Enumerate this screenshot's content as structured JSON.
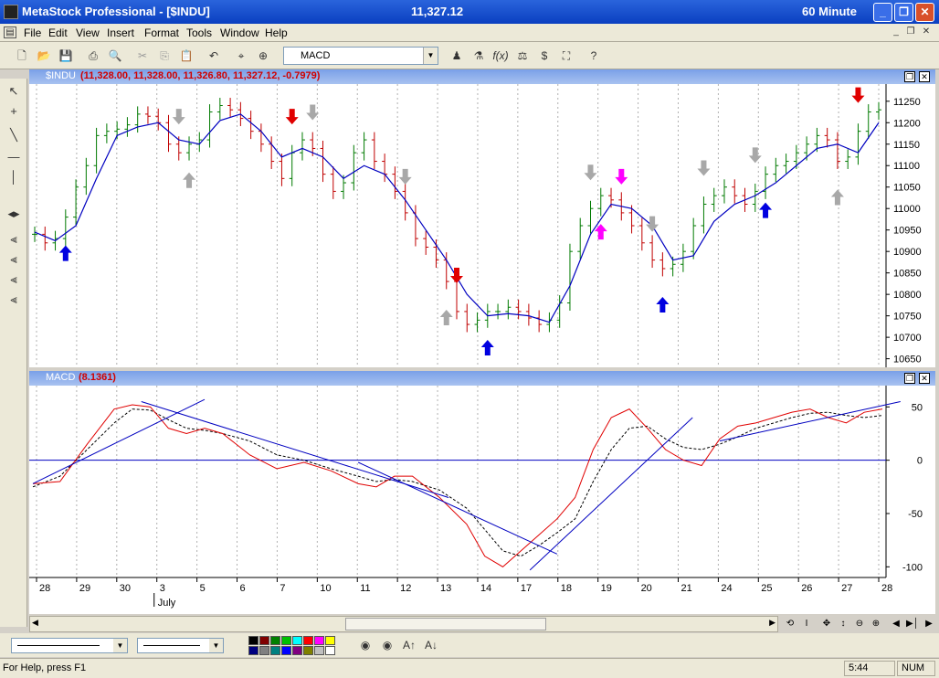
{
  "window": {
    "title": "MetaStock Professional - [$INDU]",
    "price": "11,327.12",
    "period": "60 Minute"
  },
  "menu": [
    "File",
    "Edit",
    "View",
    "Insert",
    "Format",
    "Tools",
    "Window",
    "Help"
  ],
  "toolbar": {
    "indicator_selected": "MACD"
  },
  "price_panel": {
    "name": "$INDU",
    "values": "(11,328.00, 11,328.00, 11,326.80, 11,327.12, -0.7979)",
    "yticks": [
      "11250",
      "11200",
      "11150",
      "11100",
      "11050",
      "11000",
      "10950",
      "10900",
      "10850",
      "10800",
      "10750",
      "10700",
      "10650"
    ]
  },
  "macd_panel": {
    "name": "MACD",
    "value": "(8.1361)",
    "yticks": [
      "50",
      "0",
      "-50",
      "-100"
    ]
  },
  "xaxis": {
    "dates": [
      "28",
      "29",
      "30",
      "3",
      "5",
      "6",
      "7",
      "10",
      "11",
      "12",
      "13",
      "14",
      "17",
      "18",
      "19",
      "20",
      "21",
      "24",
      "25",
      "26",
      "27",
      "28"
    ],
    "month": "July"
  },
  "status": {
    "help": "For Help, press F1",
    "time": "5:44",
    "num": "NUM"
  },
  "colors": {
    "up_bar": "#007a00",
    "down_bar": "#c00000",
    "ma_line": "#0000c0",
    "macd_line": "#e00000",
    "signal_line": "#000000",
    "trend_line": "#0000c0",
    "arrow_gray": "#a8a8a8",
    "arrow_red": "#e00000",
    "arrow_blue": "#0000e0",
    "arrow_magenta": "#ff00ff",
    "header_values": "#d00000"
  },
  "chart_data": [
    {
      "type": "candlestick-bar",
      "symbol": "$INDU",
      "interval": "60 Minute",
      "ylim": [
        10630,
        11290
      ],
      "close_path": [
        [
          0,
          10940
        ],
        [
          1,
          10920
        ],
        [
          2,
          10930
        ],
        [
          3,
          10980
        ],
        [
          4,
          11050
        ],
        [
          5,
          11100
        ],
        [
          6,
          11170
        ],
        [
          7,
          11180
        ],
        [
          8,
          11185
        ],
        [
          9,
          11195
        ],
        [
          10,
          11220
        ],
        [
          11,
          11215
        ],
        [
          12,
          11200
        ],
        [
          13,
          11150
        ],
        [
          14,
          11130
        ],
        [
          15,
          11150
        ],
        [
          16,
          11160
        ],
        [
          17,
          11225
        ],
        [
          18,
          11240
        ],
        [
          19,
          11230
        ],
        [
          20,
          11210
        ],
        [
          21,
          11180
        ],
        [
          22,
          11150
        ],
        [
          23,
          11110
        ],
        [
          24,
          11070
        ],
        [
          25,
          11130
        ],
        [
          26,
          11160
        ],
        [
          27,
          11140
        ],
        [
          28,
          11080
        ],
        [
          29,
          11040
        ],
        [
          30,
          11060
        ],
        [
          31,
          11130
        ],
        [
          32,
          11160
        ],
        [
          33,
          11110
        ],
        [
          34,
          11080
        ],
        [
          35,
          11040
        ],
        [
          36,
          10990
        ],
        [
          37,
          10930
        ],
        [
          38,
          10910
        ],
        [
          39,
          10880
        ],
        [
          40,
          10830
        ],
        [
          41,
          10760
        ],
        [
          42,
          10730
        ],
        [
          43,
          10740
        ],
        [
          44,
          10760
        ],
        [
          45,
          10760
        ],
        [
          46,
          10770
        ],
        [
          47,
          10760
        ],
        [
          48,
          10745
        ],
        [
          49,
          10730
        ],
        [
          50,
          10740
        ],
        [
          51,
          10780
        ],
        [
          52,
          10900
        ],
        [
          53,
          10960
        ],
        [
          54,
          11000
        ],
        [
          55,
          11030
        ],
        [
          56,
          11020
        ],
        [
          57,
          10990
        ],
        [
          58,
          10960
        ],
        [
          59,
          10920
        ],
        [
          60,
          10880
        ],
        [
          61,
          10860
        ],
        [
          62,
          10870
        ],
        [
          63,
          10900
        ],
        [
          64,
          10960
        ],
        [
          65,
          11010
        ],
        [
          66,
          11030
        ],
        [
          67,
          11050
        ],
        [
          68,
          11030
        ],
        [
          69,
          11010
        ],
        [
          70,
          11040
        ],
        [
          71,
          11080
        ],
        [
          72,
          11100
        ],
        [
          73,
          11110
        ],
        [
          74,
          11130
        ],
        [
          75,
          11150
        ],
        [
          76,
          11170
        ],
        [
          77,
          11160
        ],
        [
          78,
          11110
        ],
        [
          79,
          11120
        ],
        [
          80,
          11180
        ],
        [
          81,
          11225
        ],
        [
          82,
          11230
        ]
      ],
      "ma_path": [
        [
          0,
          10945
        ],
        [
          2,
          10925
        ],
        [
          4,
          10960
        ],
        [
          6,
          11070
        ],
        [
          8,
          11170
        ],
        [
          10,
          11190
        ],
        [
          12,
          11200
        ],
        [
          14,
          11160
        ],
        [
          16,
          11150
        ],
        [
          18,
          11205
        ],
        [
          20,
          11220
        ],
        [
          22,
          11180
        ],
        [
          24,
          11120
        ],
        [
          26,
          11140
        ],
        [
          28,
          11120
        ],
        [
          30,
          11070
        ],
        [
          32,
          11100
        ],
        [
          34,
          11080
        ],
        [
          36,
          11020
        ],
        [
          38,
          10950
        ],
        [
          40,
          10880
        ],
        [
          42,
          10800
        ],
        [
          44,
          10750
        ],
        [
          46,
          10755
        ],
        [
          48,
          10750
        ],
        [
          50,
          10735
        ],
        [
          52,
          10820
        ],
        [
          54,
          10940
        ],
        [
          56,
          11010
        ],
        [
          58,
          11000
        ],
        [
          60,
          10960
        ],
        [
          62,
          10880
        ],
        [
          64,
          10890
        ],
        [
          66,
          10970
        ],
        [
          68,
          11010
        ],
        [
          70,
          11030
        ],
        [
          72,
          11060
        ],
        [
          74,
          11100
        ],
        [
          76,
          11140
        ],
        [
          78,
          11150
        ],
        [
          80,
          11130
        ],
        [
          82,
          11200
        ]
      ],
      "signals": [
        {
          "color": "gray",
          "dir": "down"
        },
        {
          "color": "gray",
          "dir": "down"
        },
        {
          "color": "red",
          "dir": "down"
        },
        {
          "color": "gray",
          "dir": "down"
        },
        {
          "color": "gray",
          "dir": "down"
        },
        {
          "color": "red",
          "dir": "down"
        },
        {
          "color": "gray",
          "dir": "down"
        },
        {
          "color": "magenta",
          "dir": "down"
        },
        {
          "color": "gray",
          "dir": "down"
        },
        {
          "color": "gray",
          "dir": "down"
        },
        {
          "color": "gray",
          "dir": "down"
        },
        {
          "color": "red",
          "dir": "down"
        },
        {
          "color": "blue",
          "dir": "up"
        },
        {
          "color": "gray",
          "dir": "up"
        },
        {
          "color": "gray",
          "dir": "up"
        },
        {
          "color": "blue",
          "dir": "up"
        },
        {
          "color": "magenta",
          "dir": "up"
        },
        {
          "color": "blue",
          "dir": "up"
        },
        {
          "color": "blue",
          "dir": "up"
        },
        {
          "color": "gray",
          "dir": "up"
        }
      ]
    },
    {
      "type": "line",
      "name": "MACD",
      "ylim": [
        -110,
        70
      ],
      "macd_path": [
        [
          0,
          -22
        ],
        [
          3,
          -20
        ],
        [
          6,
          15
        ],
        [
          9,
          48
        ],
        [
          11,
          52
        ],
        [
          13,
          50
        ],
        [
          15,
          30
        ],
        [
          17,
          25
        ],
        [
          19,
          30
        ],
        [
          21,
          25
        ],
        [
          24,
          5
        ],
        [
          27,
          -8
        ],
        [
          30,
          -2
        ],
        [
          33,
          -10
        ],
        [
          36,
          -22
        ],
        [
          38,
          -25
        ],
        [
          40,
          -15
        ],
        [
          42,
          -15
        ],
        [
          45,
          -35
        ],
        [
          48,
          -60
        ],
        [
          50,
          -90
        ],
        [
          52,
          -100
        ],
        [
          54,
          -85
        ],
        [
          56,
          -70
        ],
        [
          58,
          -55
        ],
        [
          60,
          -35
        ],
        [
          62,
          10
        ],
        [
          64,
          40
        ],
        [
          66,
          48
        ],
        [
          68,
          30
        ],
        [
          70,
          10
        ],
        [
          72,
          0
        ],
        [
          74,
          -5
        ],
        [
          76,
          20
        ],
        [
          78,
          32
        ],
        [
          80,
          35
        ],
        [
          82,
          40
        ],
        [
          84,
          45
        ],
        [
          86,
          48
        ],
        [
          88,
          40
        ],
        [
          90,
          35
        ],
        [
          92,
          45
        ],
        [
          94,
          48
        ]
      ],
      "signal_path": [
        [
          0,
          -25
        ],
        [
          3,
          -15
        ],
        [
          6,
          10
        ],
        [
          9,
          35
        ],
        [
          11,
          48
        ],
        [
          13,
          47
        ],
        [
          15,
          38
        ],
        [
          17,
          30
        ],
        [
          19,
          28
        ],
        [
          21,
          25
        ],
        [
          24,
          18
        ],
        [
          27,
          5
        ],
        [
          30,
          0
        ],
        [
          33,
          -8
        ],
        [
          36,
          -15
        ],
        [
          38,
          -20
        ],
        [
          40,
          -18
        ],
        [
          42,
          -20
        ],
        [
          45,
          -28
        ],
        [
          48,
          -45
        ],
        [
          50,
          -65
        ],
        [
          52,
          -85
        ],
        [
          54,
          -90
        ],
        [
          56,
          -80
        ],
        [
          58,
          -68
        ],
        [
          60,
          -55
        ],
        [
          62,
          -20
        ],
        [
          64,
          10
        ],
        [
          66,
          30
        ],
        [
          68,
          32
        ],
        [
          70,
          20
        ],
        [
          72,
          12
        ],
        [
          74,
          10
        ],
        [
          76,
          15
        ],
        [
          78,
          22
        ],
        [
          80,
          30
        ],
        [
          82,
          35
        ],
        [
          84,
          40
        ],
        [
          86,
          44
        ],
        [
          88,
          45
        ],
        [
          90,
          42
        ],
        [
          92,
          40
        ],
        [
          94,
          42
        ]
      ]
    }
  ]
}
